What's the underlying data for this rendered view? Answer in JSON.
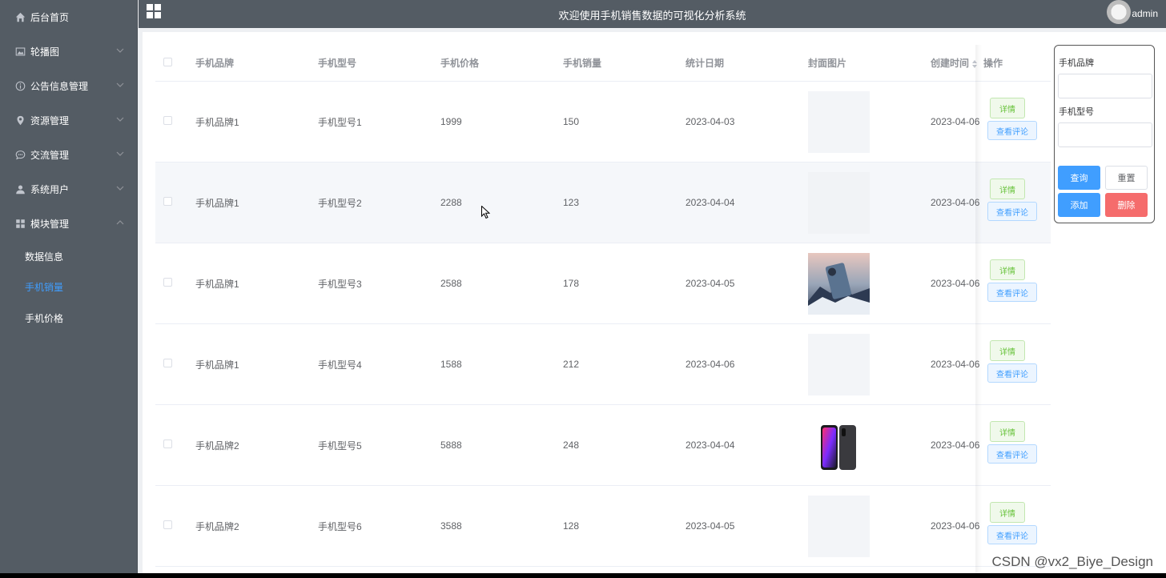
{
  "sidebar": {
    "items": [
      {
        "label": "后台首页",
        "icon": "home-icon",
        "has_sub": false
      },
      {
        "label": "轮播图",
        "icon": "image-icon",
        "has_sub": true
      },
      {
        "label": "公告信息管理",
        "icon": "info-icon",
        "has_sub": true
      },
      {
        "label": "资源管理",
        "icon": "location-icon",
        "has_sub": true
      },
      {
        "label": "交流管理",
        "icon": "chat-icon",
        "has_sub": true
      },
      {
        "label": "系统用户",
        "icon": "user-icon",
        "has_sub": true
      },
      {
        "label": "模块管理",
        "icon": "grid-icon",
        "has_sub": true,
        "expanded": true
      }
    ],
    "sub_items": [
      {
        "label": "数据信息",
        "active": false
      },
      {
        "label": "手机销量",
        "active": true
      },
      {
        "label": "手机价格",
        "active": false
      }
    ]
  },
  "header": {
    "title": "欢迎使用手机销售数据的可视化分析系统",
    "user": "admin"
  },
  "table": {
    "columns": [
      "手机品牌",
      "手机型号",
      "手机价格",
      "手机销量",
      "统计日期",
      "封面图片",
      "创建时间",
      "操作"
    ],
    "rows": [
      {
        "brand": "手机品牌1",
        "model": "手机型号1",
        "price": "1999",
        "sales": "150",
        "date": "2023-04-03",
        "image": "blank",
        "created": "2023-04-06"
      },
      {
        "brand": "手机品牌1",
        "model": "手机型号2",
        "price": "2288",
        "sales": "123",
        "date": "2023-04-04",
        "image": "blank",
        "created": "2023-04-06"
      },
      {
        "brand": "手机品牌1",
        "model": "手机型号3",
        "price": "2588",
        "sales": "178",
        "date": "2023-04-05",
        "image": "phone-photo",
        "created": "2023-04-06"
      },
      {
        "brand": "手机品牌1",
        "model": "手机型号4",
        "price": "1588",
        "sales": "212",
        "date": "2023-04-06",
        "image": "blank",
        "created": "2023-04-06"
      },
      {
        "brand": "手机品牌2",
        "model": "手机型号5",
        "price": "5888",
        "sales": "248",
        "date": "2023-04-04",
        "image": "iphone-photo",
        "created": "2023-04-06"
      },
      {
        "brand": "手机品牌2",
        "model": "手机型号6",
        "price": "3588",
        "sales": "128",
        "date": "2023-04-05",
        "image": "blank",
        "created": "2023-04-06"
      }
    ],
    "actions": {
      "detail": "详情",
      "comments": "查看评论"
    }
  },
  "search": {
    "brand_label": "手机品牌",
    "model_label": "手机型号",
    "query": "查询",
    "reset": "重置",
    "add": "添加",
    "delete": "删除"
  },
  "watermark": "CSDN @vx2_Biye_Design",
  "colors": {
    "sidebar_bg": "#545c64",
    "accent": "#409eff",
    "success": "#67c23a",
    "danger": "#f56c6c"
  }
}
